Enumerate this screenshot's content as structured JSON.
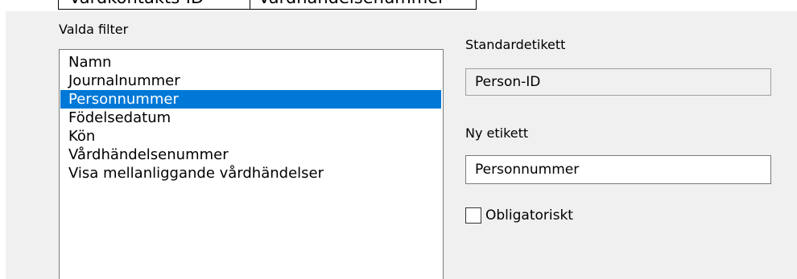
{
  "tabs": [
    {
      "label": "Vårdkontakts-ID"
    },
    {
      "label": "Vårdhändelsenummer"
    }
  ],
  "filters": {
    "heading": "Valda filter",
    "items": [
      {
        "label": "Namn"
      },
      {
        "label": "Journalnummer"
      },
      {
        "label": "Personnummer",
        "selected": true
      },
      {
        "label": "Födelsedatum"
      },
      {
        "label": "Kön"
      },
      {
        "label": "Vårdhändelsenummer"
      },
      {
        "label": "Visa mellanliggande vårdhändelser"
      }
    ]
  },
  "details": {
    "default_label_heading": "Standardetikett",
    "default_label_value": "Person-ID",
    "new_label_heading": "Ny etikett",
    "new_label_value": "Personnummer",
    "required_label": "Obligatoriskt",
    "required_checked": false
  },
  "colors": {
    "selection": "#0078d7",
    "panel_background": "#f0f0f0"
  }
}
